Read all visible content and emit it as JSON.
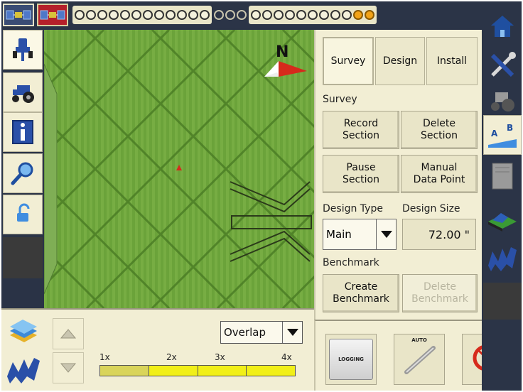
{
  "top_bar": {
    "sat_icons": [
      "satellite-icon",
      "satellite-warning-icon"
    ],
    "leds": {
      "group1": 12,
      "group2": 3,
      "group3_white": 9,
      "group3_orange": 2
    },
    "colors": {
      "led_orange": "#f2a317",
      "sat_alert_bg": "#b5202a"
    }
  },
  "left_tools": [
    "guidance-lightbar-icon",
    "tractor-icon",
    "info-icon",
    "zoom-icon",
    "unlock-icon"
  ],
  "map": {
    "compass_label": "N",
    "colors": {
      "field": "#6ba33a",
      "coverage_line": "#3d6f1c",
      "position_marker": "#d62a1c"
    }
  },
  "bottom_left": {
    "overlap": {
      "value": "Overlap"
    },
    "scale": {
      "labels": [
        "1x",
        "2x",
        "3x",
        "4x"
      ]
    }
  },
  "right_panel": {
    "tabs": [
      {
        "label": "Survey",
        "active": true
      },
      {
        "label": "Design",
        "active": false
      },
      {
        "label": "Install",
        "active": false
      }
    ],
    "survey_section_label": "Survey",
    "buttons": {
      "record_section": [
        "Record",
        "Section"
      ],
      "delete_section": [
        "Delete",
        "Section"
      ],
      "pause_section": [
        "Pause",
        "Section"
      ],
      "manual_data_point": [
        "Manual",
        "Data Point"
      ]
    },
    "design_type_label": "Design Type",
    "design_size_label": "Design Size",
    "design_type_value": "Main",
    "design_size_value": "72.00 \"",
    "benchmark_label": "Benchmark",
    "create_benchmark": [
      "Create",
      "Benchmark"
    ],
    "delete_benchmark": [
      "Delete",
      "Benchmark"
    ]
  },
  "bottom_right": {
    "logging_label": "LOGGING",
    "auto_label": "AUTO"
  },
  "right_tools": [
    "home-icon",
    "tools-icon",
    "tractor-settings-icon",
    "ab-line-icon",
    "storage-icon",
    "3d-terrain-icon",
    "brand-logo-icon"
  ]
}
